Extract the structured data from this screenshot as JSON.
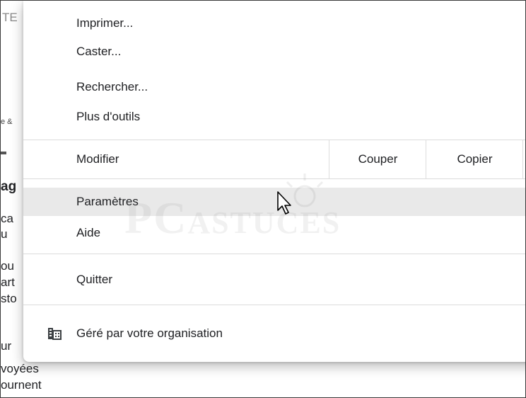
{
  "background_fragments": {
    "line1": "TE",
    "line2": "e &",
    "line3": "ag",
    "line4": "ca",
    "line5": "u",
    "line6": "ou",
    "line7": "art",
    "line8": "sto",
    "line9": "ur",
    "line10": "voyées",
    "line11": "ournent"
  },
  "menu": {
    "items": {
      "print": "Imprimer...",
      "cast": "Caster...",
      "search": "Rechercher...",
      "more_tools": "Plus d'outils",
      "edit": "Modifier",
      "cut": "Couper",
      "copy": "Copier",
      "settings": "Paramètres",
      "help": "Aide",
      "quit": "Quitter",
      "managed": "Géré par votre organisation"
    },
    "hovered_item": "Paramètres"
  },
  "watermark": {
    "big": "PC",
    "rest": "ASTUCES"
  },
  "icons": {
    "managed": "building-icon",
    "cursor": "mouse-pointer-icon"
  }
}
